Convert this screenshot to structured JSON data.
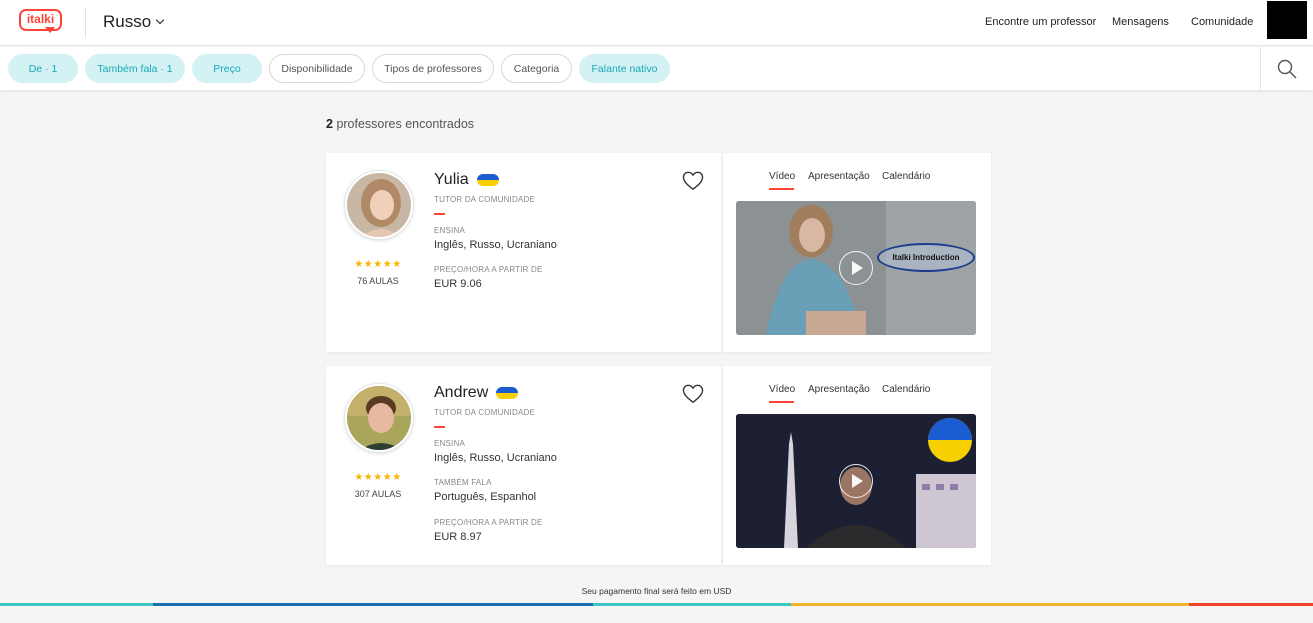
{
  "header": {
    "logo_text": "italki",
    "language": "Russo",
    "nav": [
      "Encontre um professor",
      "Mensagens",
      "Comunidade"
    ]
  },
  "filters": [
    {
      "label": "De · 1",
      "active": true
    },
    {
      "label": "Também fala · 1",
      "active": true
    },
    {
      "label": "Preço",
      "active": true
    },
    {
      "label": "Disponibilidade",
      "active": false
    },
    {
      "label": "Tipos de professores",
      "active": false
    },
    {
      "label": "Categoria",
      "active": false
    },
    {
      "label": "Falante nativo",
      "active": true
    }
  ],
  "results": {
    "count": "2",
    "label": "professores encontrados"
  },
  "tabs": [
    "Vídeo",
    "Apresentação",
    "Calendário"
  ],
  "teachers": [
    {
      "name": "Yulia",
      "flag": "ukraine-flag",
      "type": "TUTOR DA COMUNIDADE",
      "teaches_label": "ENSINA",
      "teaches": "Inglês, Russo, Ucraniano",
      "price_label": "PREÇO/HORA A PARTIR DE",
      "price": "EUR 9.06",
      "rating": "★★★★★",
      "lessons": "76 AULAS",
      "video_caption": "Italki Introduction"
    },
    {
      "name": "Andrew",
      "flag": "ukraine-flag",
      "type": "TUTOR DA COMUNIDADE",
      "teaches_label": "ENSINA",
      "teaches": "Inglês, Russo, Ucraniano",
      "also_label": "TAMBÉM FALA",
      "also": "Português, Espanhol",
      "price_label": "PREÇO/HORA A PARTIR DE",
      "price": "EUR 8.97",
      "rating": "★★★★★",
      "lessons": "307 AULAS"
    }
  ],
  "footer": {
    "note": "Seu pagamento final será feito em USD"
  },
  "colors": {
    "brand_red": "#ff4438",
    "chip_bg": "#d4f1f3",
    "chip_text": "#16a9b5",
    "star": "#f7b500",
    "bar": [
      "#3ec7c1",
      "#1b6fb5",
      "#3ec7c1",
      "#f5b52b",
      "#f0422f"
    ]
  }
}
